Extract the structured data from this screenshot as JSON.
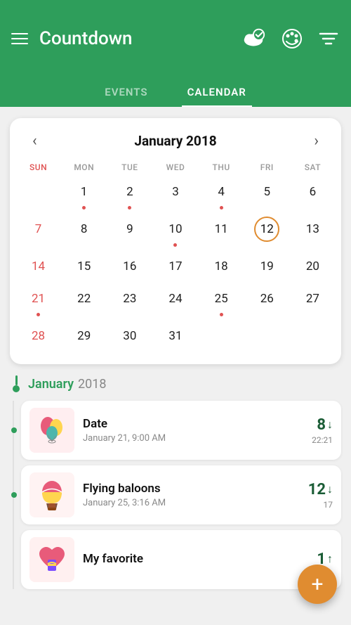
{
  "header": {
    "title": "Countdown",
    "hamburger_label": "Menu",
    "cloud_icon": "cloud-check",
    "palette_icon": "palette",
    "filter_icon": "filter"
  },
  "tabs": [
    {
      "id": "events",
      "label": "EVENTS",
      "active": false
    },
    {
      "id": "calendar",
      "label": "CALENDAR",
      "active": true
    }
  ],
  "calendar": {
    "month_year": "January 2018",
    "prev_label": "‹",
    "next_label": "›",
    "day_headers": [
      "SUN",
      "MON",
      "TUE",
      "WED",
      "THU",
      "FRI",
      "SAT"
    ],
    "today_day": 12,
    "weeks": [
      [
        {
          "day": "",
          "dot": false
        },
        {
          "day": "1",
          "dot": true
        },
        {
          "day": "2",
          "dot": true
        },
        {
          "day": "3",
          "dot": false
        },
        {
          "day": "4",
          "dot": true
        },
        {
          "day": "5",
          "dot": false
        },
        {
          "day": "6",
          "dot": false
        }
      ],
      [
        {
          "day": "7",
          "dot": false
        },
        {
          "day": "8",
          "dot": false
        },
        {
          "day": "9",
          "dot": false
        },
        {
          "day": "10",
          "dot": true
        },
        {
          "day": "11",
          "dot": false
        },
        {
          "day": "12",
          "dot": false,
          "today": true
        },
        {
          "day": "13",
          "dot": false
        }
      ],
      [
        {
          "day": "14",
          "dot": false
        },
        {
          "day": "15",
          "dot": false
        },
        {
          "day": "16",
          "dot": false
        },
        {
          "day": "17",
          "dot": false
        },
        {
          "day": "18",
          "dot": false
        },
        {
          "day": "19",
          "dot": false
        },
        {
          "day": "20",
          "dot": false
        }
      ],
      [
        {
          "day": "21",
          "dot": true
        },
        {
          "day": "22",
          "dot": false
        },
        {
          "day": "23",
          "dot": false
        },
        {
          "day": "24",
          "dot": false
        },
        {
          "day": "25",
          "dot": true
        },
        {
          "day": "26",
          "dot": false
        },
        {
          "day": "27",
          "dot": false
        }
      ],
      [
        {
          "day": "28",
          "dot": false
        },
        {
          "day": "29",
          "dot": false
        },
        {
          "day": "30",
          "dot": false
        },
        {
          "day": "31",
          "dot": false
        },
        {
          "day": "",
          "dot": false
        },
        {
          "day": "",
          "dot": false
        },
        {
          "day": "",
          "dot": false
        }
      ]
    ]
  },
  "events_section": {
    "month_label_green": "January",
    "month_label_gray": "2018",
    "events": [
      {
        "id": "date-event",
        "name": "Date",
        "date": "January 21, 9:00 AM",
        "count": "8",
        "count_direction": "down",
        "time_detail": "22:21",
        "thumb_type": "balloons",
        "dot": true
      },
      {
        "id": "flying-balloons-event",
        "name": "Flying baloons",
        "date": "January 25, 3:16 AM",
        "count": "12",
        "count_direction": "down",
        "time_detail": "17",
        "thumb_type": "air-balloon",
        "dot": true
      },
      {
        "id": "my-favorite-event",
        "name": "My favorite",
        "date": "",
        "count": "1",
        "count_direction": "up",
        "time_detail": "",
        "thumb_type": "heart",
        "dot": false
      }
    ]
  },
  "fab": {
    "label": "+"
  }
}
